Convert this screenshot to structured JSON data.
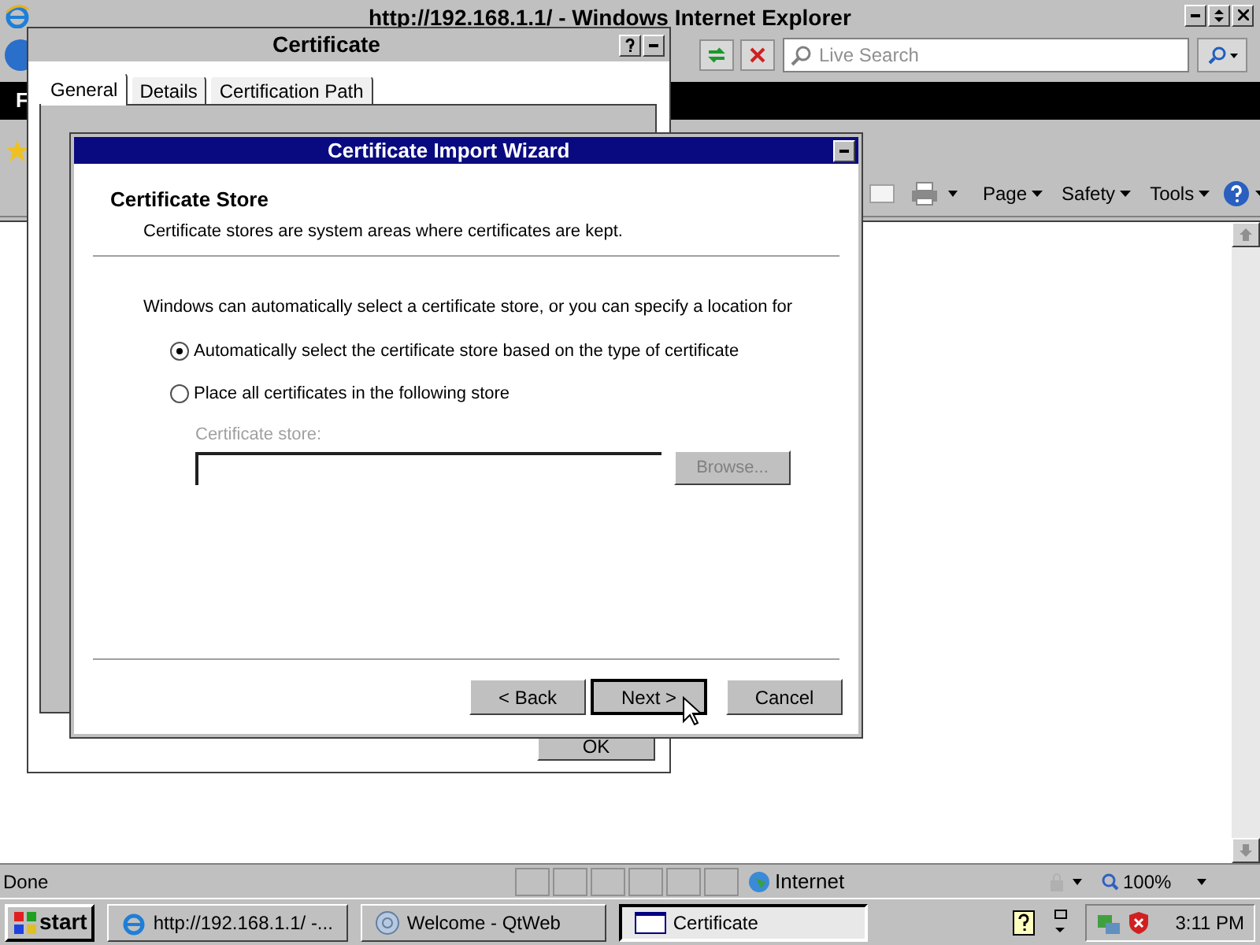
{
  "browser": {
    "title": "http://192.168.1.1/ - Windows Internet Explorer",
    "search": {
      "placeholder": "Live Search"
    },
    "banner_text": "F",
    "command_bar": [
      "Page",
      "Safety",
      "Tools"
    ],
    "status_bar": {
      "status": "Done",
      "zone": "Internet",
      "zoom": "100%"
    }
  },
  "certificate_dialog": {
    "title": "Certificate",
    "tabs": [
      {
        "label": "General",
        "selected": true
      },
      {
        "label": "Details",
        "selected": false
      },
      {
        "label": "Certification Path",
        "selected": false
      }
    ],
    "button": "OK"
  },
  "wizard": {
    "title": "Certificate Import Wizard",
    "heading": "Certificate Store",
    "subheading": "Certificate stores are system areas where certificates are kept.",
    "intro": "Windows can automatically select a certificate store, or you can specify a location for",
    "options": [
      {
        "label": "Automatically select the certificate store based on the type of certificate",
        "selected": true
      },
      {
        "label": "Place all certificates in the following store",
        "selected": false
      }
    ],
    "store": {
      "label": "Certificate store:",
      "disabled": true,
      "browse": "Browse..."
    },
    "buttons": [
      {
        "label": "< Back",
        "default": false
      },
      {
        "label": "Next >",
        "default": true
      },
      {
        "label": "Cancel",
        "default": false
      }
    ]
  },
  "taskbar": {
    "start": "start",
    "tasks": [
      {
        "label": "http://192.168.1.1/ -...",
        "selected": false
      },
      {
        "label": "Welcome - QtWeb",
        "selected": false
      },
      {
        "label": "Certificate",
        "selected": true
      }
    ],
    "clock": "3:11 PM"
  }
}
